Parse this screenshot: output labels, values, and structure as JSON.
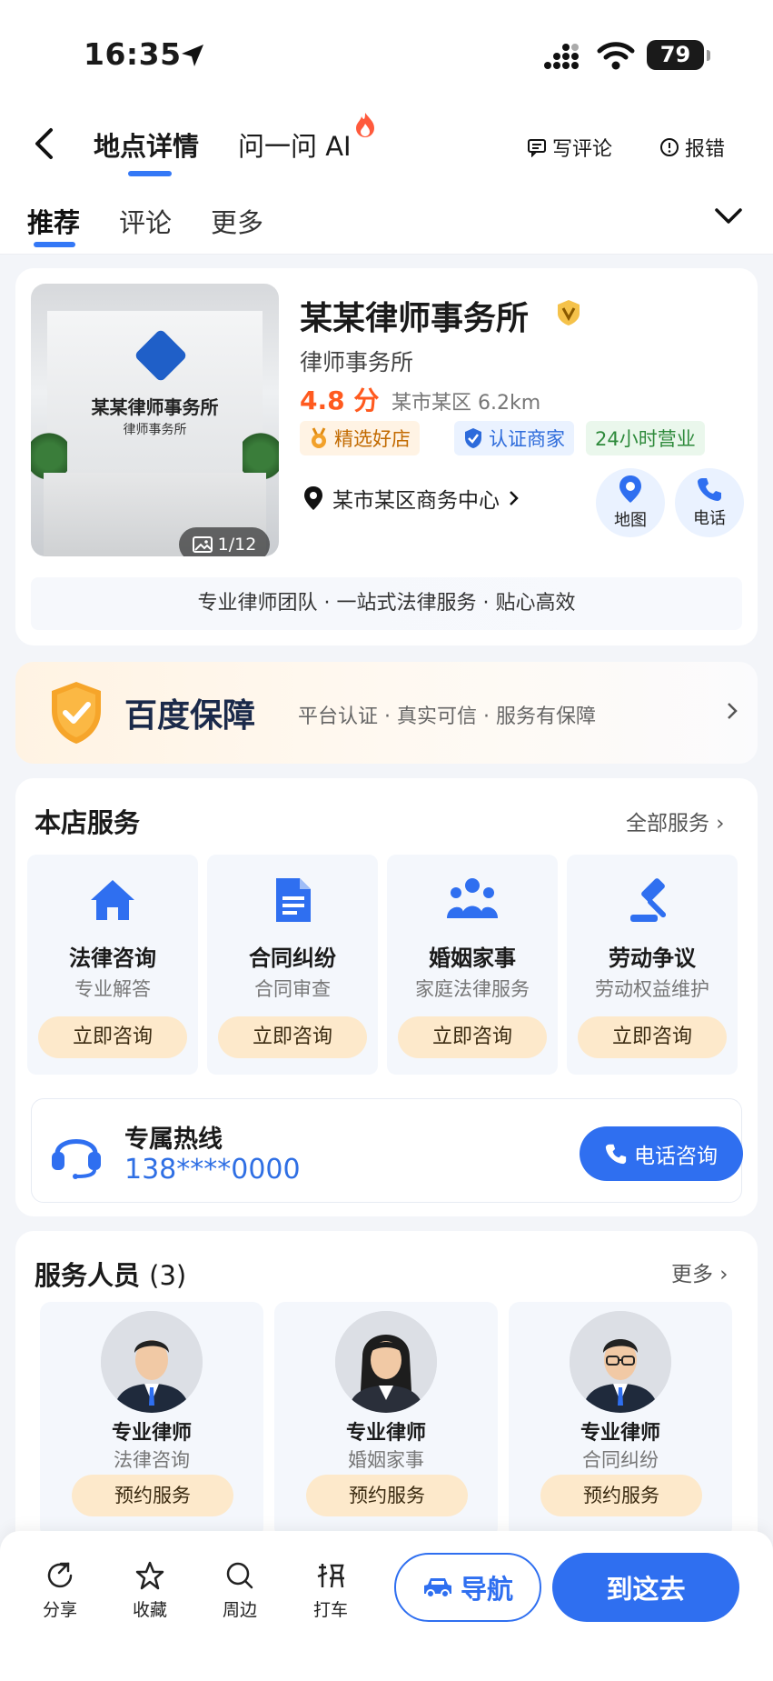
{
  "status": {
    "time": "16:35",
    "battery": "79"
  },
  "nav": {
    "tab_detail": "地点详情",
    "tab_ai": "问一问 AI",
    "write_review": "写评论",
    "report": "报错"
  },
  "subtabs": [
    "推荐",
    "评论",
    "更多"
  ],
  "shop": {
    "photo_title": "某某律师事务所",
    "photo_subtitle": "律师事务所",
    "photo_count": "1/12",
    "name": "某某律师事务所",
    "category": "律师事务所",
    "score": "4.8 分",
    "area": "某市某区  6.2km",
    "tags": [
      "精选好店",
      "认证商家",
      "24小时营业"
    ],
    "address": "某市某区商务中心",
    "map_label": "地图",
    "phone_label": "电话",
    "slogan": "专业律师团队 · 一站式法律服务 · 贴心高效"
  },
  "guarantee": {
    "title": "百度保障",
    "subtitle": "平台认证 · 真实可信 · 服务有保障"
  },
  "services": {
    "title": "本店服务",
    "all": "全部服务",
    "items": [
      {
        "name": "法律咨询",
        "desc": "专业解答",
        "button": "立即咨询",
        "icon": "home-icon"
      },
      {
        "name": "合同纠纷",
        "desc": "合同审查",
        "button": "立即咨询",
        "icon": "document-icon"
      },
      {
        "name": "婚姻家事",
        "desc": "家庭法律服务",
        "button": "立即咨询",
        "icon": "family-icon"
      },
      {
        "name": "劳动争议",
        "desc": "劳动权益维护",
        "button": "立即咨询",
        "icon": "gavel-icon"
      }
    ],
    "hotline_title": "专属热线",
    "hotline_number": "138****0000",
    "hotline_button": "电话咨询"
  },
  "staff": {
    "title": "服务人员",
    "count": "(3)",
    "more": "更多",
    "people": [
      {
        "title": "专业律师",
        "field": "法律咨询",
        "button": "预约服务"
      },
      {
        "title": "专业律师",
        "field": "婚姻家事",
        "button": "预约服务"
      },
      {
        "title": "专业律师",
        "field": "合同纠纷",
        "button": "预约服务"
      }
    ]
  },
  "bottom": {
    "share": "分享",
    "favorite": "收藏",
    "nearby": "周边",
    "taxi": "打车",
    "navigate": "导航",
    "go": "到这去"
  },
  "colors": {
    "accent": "#2f6ff0",
    "score": "#ff5a1f"
  }
}
